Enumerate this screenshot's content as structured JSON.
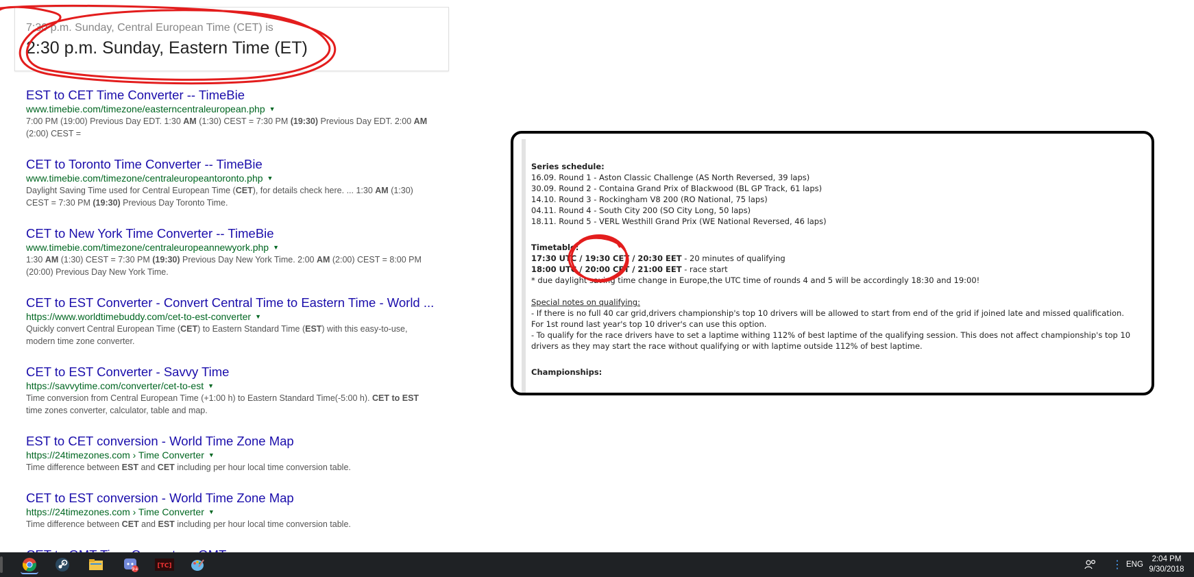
{
  "answer": {
    "subtitle": "7:30 p.m. Sunday, Central European Time (CET) is",
    "main": "2:30 p.m. Sunday, Eastern Time (ET)"
  },
  "results": [
    {
      "title": "EST to CET Time Converter -- TimeBie",
      "url": "www.timebie.com/timezone/easterncentraleuropean.php",
      "snippet": "7:00 PM (19:00) Previous Day EDT. 1:30 AM (1:30) CEST = 7:30 PM (19:30) Previous Day EDT. 2:00 AM (2:00) CEST ="
    },
    {
      "title": "CET to Toronto Time Converter -- TimeBie",
      "url": "www.timebie.com/timezone/centraleuropeantoronto.php",
      "snippet": "Daylight Saving Time used for Central European Time (CET), for details check here. ... 1:30 AM (1:30) CEST = 7:30 PM (19:30) Previous Day Toronto Time."
    },
    {
      "title": "CET to New York Time Converter -- TimeBie",
      "url": "www.timebie.com/timezone/centraleuropeannewyork.php",
      "snippet": "1:30 AM (1:30) CEST = 7:30 PM (19:30) Previous Day New York Time. 2:00 AM (2:00) CEST = 8:00 PM (20:00) Previous Day New York Time."
    },
    {
      "title": "CET to EST Converter - Convert Central Time to Eastern Time - World ...",
      "url": "https://www.worldtimebuddy.com/cet-to-est-converter",
      "snippet": "Quickly convert Central European Time (CET) to Eastern Standard Time (EST) with this easy-to-use, modern time zone converter."
    },
    {
      "title": "CET to EST Converter - Savvy Time",
      "url": "https://savvytime.com/converter/cet-to-est",
      "snippet": "Time conversion from Central European Time (+1:00 h) to Eastern Standard Time(-5:00 h). CET to EST time zones converter, calculator, table and map."
    },
    {
      "title": "EST to CET conversion - World Time Zone Map",
      "url": "https://24timezones.com › Time Converter",
      "snippet": "Time difference between EST and CET including per hour local time conversion table."
    },
    {
      "title": "CET to EST conversion - World Time Zone Map",
      "url": "https://24timezones.com › Time Converter",
      "snippet": "Time difference between CET and EST including per hour local time conversion table."
    },
    {
      "title": "CET to GMT Time Converter - GMT",
      "url": "",
      "snippet": ""
    }
  ],
  "forum": {
    "schedule_heading": "Series schedule:",
    "schedule": [
      "16.09. Round 1 - Aston Classic Challenge (AS North Reversed, 39 laps)",
      "30.09. Round 2 - Containa Grand Prix of Blackwood (BL GP Track, 61 laps)",
      "14.10. Round 3 - Rockingham V8 200 (RO National, 75 laps)",
      "04.11. Round 4 - South City 200 (SO City Long, 50 laps)",
      "18.11. Round 5 - VERL Westhill Grand Prix (WE National Reversed, 46 laps)"
    ],
    "timetable_heading": "Timetable:",
    "timetable": [
      {
        "times": "17:30 UTC / 19:30 CET / 20:30 EET",
        "desc": " - 20 minutes of qualifying"
      },
      {
        "times": "18:00 UTC / 20:00 CET / 21:00 EET",
        "desc": " - race start"
      }
    ],
    "timetable_note": "* due daylight saving time change in Europe,the UTC time of rounds 4 and 5 will be accordingly 18:30 and 19:00!",
    "notes_heading": "Special notes on qualifying:",
    "notes": [
      "- If there is no full 40 car grid,drivers championship's top 10 drivers will be allowed to start from end of the grid if joined late and missed qualification. For 1st round last year's top 10 driver's can use this option.",
      "- To qualify for the race drivers have to set a laptime withing 112% of best laptime of the qualifying session. This does not affect championship's top 10 drivers as they may start the race without qualifying or with laptime outside 112% of best laptime."
    ],
    "championships_heading": "Championships:"
  },
  "taskbar": {
    "apps": [
      {
        "name": "chrome-icon",
        "color": "#db4437"
      },
      {
        "name": "steam-icon",
        "color": "#1b2838"
      },
      {
        "name": "file-explorer-icon",
        "color": "#f3c64b"
      },
      {
        "name": "discord-icon",
        "color": "#7289da",
        "badge": "9+"
      },
      {
        "name": "tc-app-icon",
        "color": "#b31b1b",
        "label": "[TC]"
      },
      {
        "name": "paint-icon",
        "color": "#6ab7e8"
      }
    ],
    "language": "ENG",
    "time": "2:04 PM",
    "date": "9/30/2018"
  }
}
